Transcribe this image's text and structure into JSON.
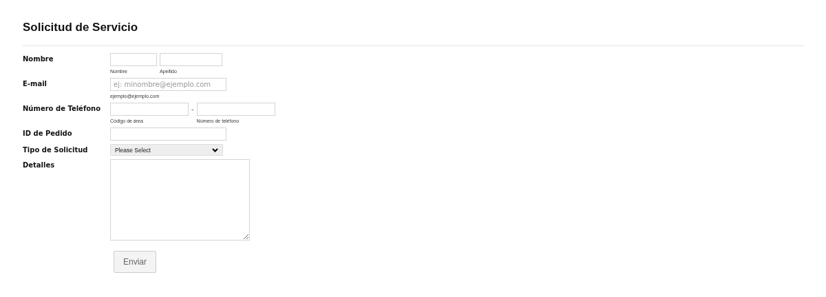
{
  "title": "Solicitud de Servicio",
  "fields": [
    {
      "kind": "split",
      "label": "Nombre",
      "inputs": [
        {
          "sublabel": "Nombre"
        },
        {
          "sublabel": "Apellido"
        }
      ]
    },
    {
      "kind": "text",
      "label": "E-mail",
      "placeholder": "ej: minombre@ejemplo.com",
      "sublabel": "ejemplo@ejemplo.com"
    },
    {
      "kind": "phone",
      "label": "Número de Teléfono",
      "separator": "-",
      "inputs": [
        {
          "sublabel": "Código de área"
        },
        {
          "sublabel": "Número de teléfono"
        }
      ]
    },
    {
      "kind": "text",
      "label": "ID de Pedido"
    },
    {
      "kind": "select",
      "label": "Tipo de Solicitud",
      "value": "Please Select"
    },
    {
      "kind": "textarea",
      "label": "Detalles"
    }
  ],
  "submit": "Enviar"
}
